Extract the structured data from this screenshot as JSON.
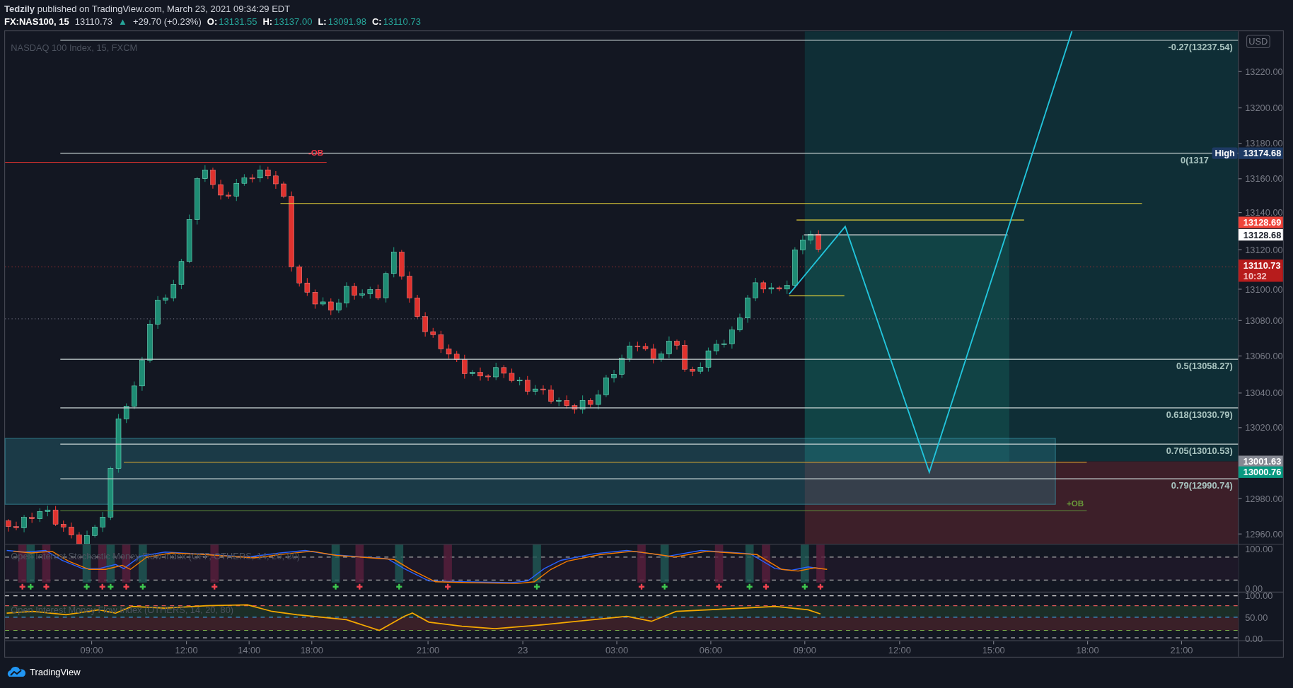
{
  "header": {
    "publisher_line": "**Tedzily** published on TradingView.com, March 23, 2021 09:34:29 EDT",
    "symbol": "FX:NAS100, 15",
    "last": "13110.73",
    "direction": "▲",
    "change": "+29.70 (+0.23%)",
    "ohlc": [
      {
        "label": "O:",
        "value": "13131.55"
      },
      {
        "label": "H:",
        "value": "13137.00"
      },
      {
        "label": "L:",
        "value": "13091.98"
      },
      {
        "label": "C:",
        "value": "13110.73"
      }
    ]
  },
  "chart": {
    "legend": "NASDAQ 100 Index, 15, FXCM",
    "currency": "USD",
    "price_ticks": [
      "13220.00",
      "13200.00",
      "13180.00",
      "13160.00",
      "13140.00",
      "13120.00",
      "13100.00",
      "13080.00",
      "13060.00",
      "13040.00",
      "13020.00",
      "12980.00",
      "12960.00"
    ],
    "fib_levels": [
      {
        "label": "-0.27(13237.54)"
      },
      {
        "label": "0(1317"
      },
      {
        "label": "0.5(13058.27)"
      },
      {
        "label": "0.618(13030.79)"
      },
      {
        "label": "0.705(13010.53)"
      },
      {
        "label": "0.79(12990.74)"
      }
    ],
    "zone_labels": [
      {
        "text": "-OB",
        "color": "#f23645"
      },
      {
        "text": "+OB",
        "color": "#6a9a3a"
      }
    ],
    "price_tags": [
      {
        "kind": "tagged",
        "tag": "High",
        "value": "13174.68",
        "color": "#1e3a64"
      },
      {
        "kind": "plain",
        "value": "13128.69",
        "color": "#f0443a"
      },
      {
        "kind": "plain",
        "value": "13128.68",
        "color": "#ffffff"
      },
      {
        "kind": "timer",
        "value": "13110.73",
        "sub": "10:32",
        "color": "#b71c1c"
      },
      {
        "kind": "plain",
        "value": "13001.63",
        "color": "#868993"
      },
      {
        "kind": "plain",
        "value": "13000.76",
        "color": "#089981"
      }
    ]
  },
  "indicators": [
    {
      "title": "Open Interest Stochastic Money Flow Index (OFF, OTHERS, 14, 20, 80)",
      "ticks": [
        "100.00",
        "0.00"
      ]
    },
    {
      "title": "Open Interest Money Flow Index (OTHERS, 14, 20, 80)",
      "ticks": [
        "100.00",
        "50.00",
        "0.00"
      ]
    }
  ],
  "time_axis": [
    "09:00",
    "12:00",
    "14:00",
    "18:00",
    "21:00",
    "23",
    "03:00",
    "06:00",
    "09:00",
    "12:00",
    "15:00",
    "18:00",
    "21:00"
  ],
  "footer": {
    "brand": "TradingView"
  }
}
